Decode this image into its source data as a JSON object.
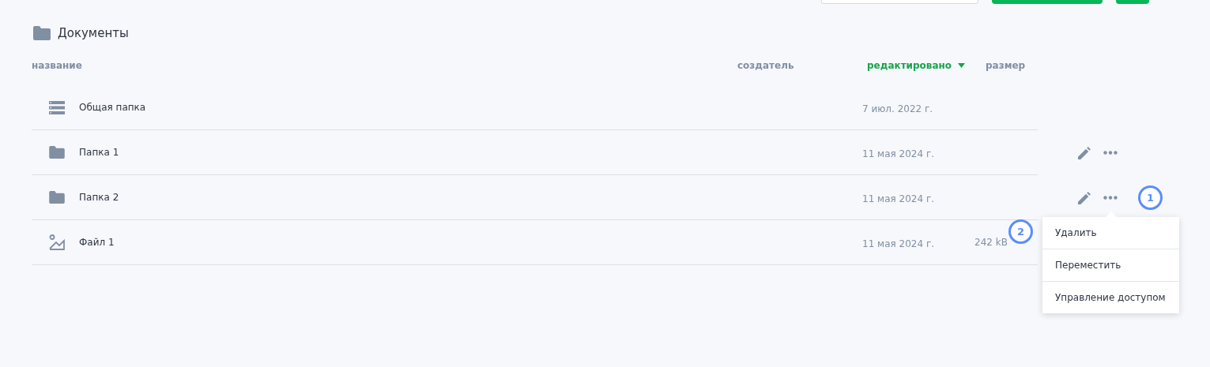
{
  "breadcrumb": {
    "title": "Документы"
  },
  "columns": [
    {
      "label": "название",
      "sorted": false
    },
    {
      "label": "создатель",
      "sorted": false
    },
    {
      "label": "редактировано",
      "sorted": true
    },
    {
      "label": "размер",
      "sorted": false
    }
  ],
  "rows": [
    {
      "kind": "shared",
      "name": "Общая папка",
      "edited": "7 июл. 2022 г.",
      "actions_visible": false
    },
    {
      "kind": "folder",
      "name": "Папка 1",
      "edited": "11 мая 2024 г.",
      "actions_visible": true
    },
    {
      "kind": "folder",
      "name": "Папка 2",
      "edited": "11 мая 2024 г.",
      "actions_visible": true,
      "callout": "1",
      "menu": {
        "callout": "2",
        "items": [
          "Удалить",
          "Переместить",
          "Управление доступом"
        ]
      }
    },
    {
      "kind": "file",
      "name": "Файл 1",
      "edited": "11 мая 2024 г.",
      "size": "242 kB"
    }
  ]
}
